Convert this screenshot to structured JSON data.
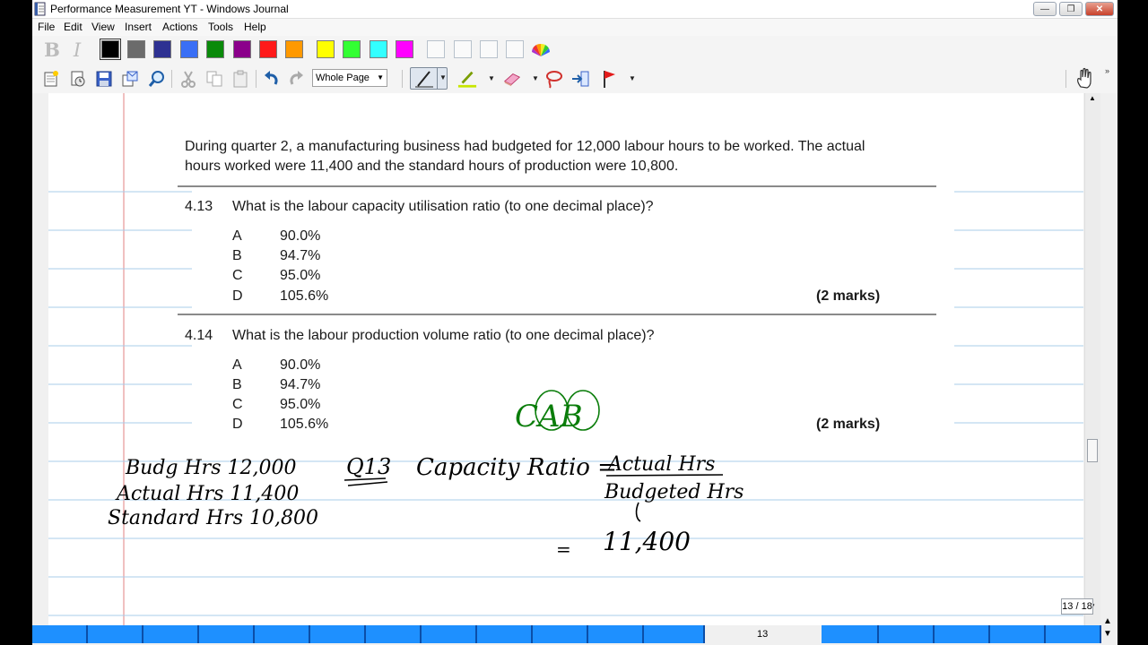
{
  "window": {
    "title": "Performance Measurement YT - Windows Journal"
  },
  "menu": [
    "File",
    "Edit",
    "View",
    "Insert",
    "Actions",
    "Tools",
    "Help"
  ],
  "toolbar": {
    "format": [
      "B",
      "I"
    ],
    "pen_colors": [
      "#000000",
      "#6b6b6b",
      "#2e3192",
      "#3a6ff5",
      "#0a8a0a",
      "#8b008b",
      "#ff1a1a",
      "#ff9900",
      "#ffff00",
      "#33ff33",
      "#33ffff",
      "#ff00ff"
    ],
    "zoom": "Whole Page"
  },
  "document": {
    "intro_line1": "During quarter 2, a manufacturing business had budgeted for 12,000 labour hours to be worked. The actual",
    "intro_line2": "hours worked were 11,400 and the standard hours of production were 10,800.",
    "questions": [
      {
        "number": "4.13",
        "text": "What is the labour capacity utilisation ratio (to one decimal place)?",
        "options": [
          {
            "letter": "A",
            "value": "90.0%"
          },
          {
            "letter": "B",
            "value": "94.7%"
          },
          {
            "letter": "C",
            "value": "95.0%"
          },
          {
            "letter": "D",
            "value": "105.6%"
          }
        ],
        "marks": "(2 marks)"
      },
      {
        "number": "4.14",
        "text": "What is the labour production volume ratio (to one decimal place)?",
        "options": [
          {
            "letter": "A",
            "value": "90.0%"
          },
          {
            "letter": "B",
            "value": "94.7%"
          },
          {
            "letter": "C",
            "value": "95.0%"
          },
          {
            "letter": "D",
            "value": "105.6%"
          }
        ],
        "marks": "(2 marks)"
      }
    ]
  },
  "handwriting": {
    "notes": [
      "Budg Hrs 12,000",
      "Actual Hrs 11,400",
      "Standard Hrs 10,800"
    ],
    "q_label": "Q13",
    "formula_label": "Capacity Ratio =",
    "numerator": "Actual Hrs",
    "denominator": "Budgeted Hrs",
    "eq_sign": "=",
    "value": "11,400",
    "annotation": "CAB"
  },
  "status": {
    "page_indicator": "13 / 18",
    "page_number": "13"
  }
}
